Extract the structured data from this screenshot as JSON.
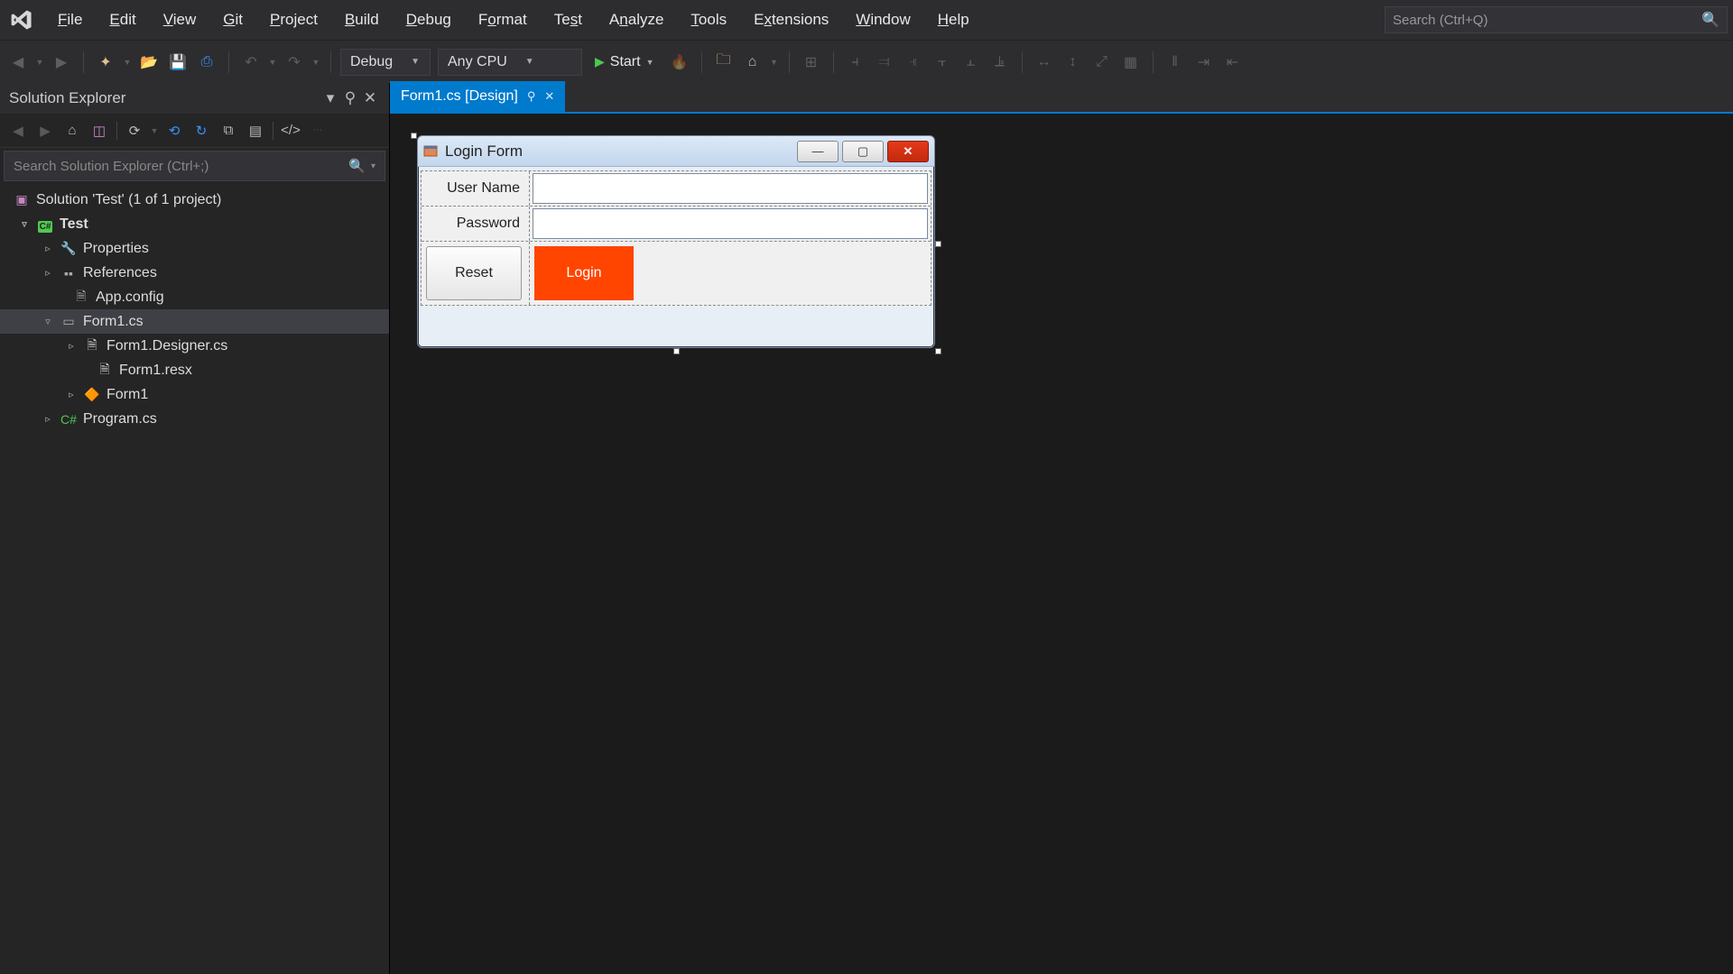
{
  "menubar": {
    "items": [
      {
        "label": "File",
        "mn": "F"
      },
      {
        "label": "Edit",
        "mn": "E"
      },
      {
        "label": "View",
        "mn": "V"
      },
      {
        "label": "Git",
        "mn": "G"
      },
      {
        "label": "Project",
        "mn": "P"
      },
      {
        "label": "Build",
        "mn": "B"
      },
      {
        "label": "Debug",
        "mn": "D"
      },
      {
        "label": "Format",
        "mn": ""
      },
      {
        "label": "Test",
        "mn": ""
      },
      {
        "label": "Analyze",
        "mn": "A"
      },
      {
        "label": "Tools",
        "mn": "T"
      },
      {
        "label": "Extensions",
        "mn": ""
      },
      {
        "label": "Window",
        "mn": "W"
      },
      {
        "label": "Help",
        "mn": "H"
      }
    ],
    "search_placeholder": "Search (Ctrl+Q)"
  },
  "toolbar": {
    "config_label": "Debug",
    "platform_label": "Any CPU",
    "start_label": "Start"
  },
  "solution_explorer": {
    "title": "Solution Explorer",
    "search_placeholder": "Search Solution Explorer (Ctrl+;)",
    "tree": {
      "solution_label": "Solution 'Test' (1 of 1 project)",
      "project_label": "Test",
      "properties_label": "Properties",
      "references_label": "References",
      "appconfig_label": "App.config",
      "form_label": "Form1.cs",
      "designer_label": "Form1.Designer.cs",
      "resx_label": "Form1.resx",
      "formclass_label": "Form1",
      "program_label": "Program.cs"
    }
  },
  "tab": {
    "label": "Form1.cs [Design]"
  },
  "designer_form": {
    "title": "Login Form",
    "labels": {
      "username": "User Name",
      "password": "Password"
    },
    "buttons": {
      "reset": "Reset",
      "login": "Login"
    },
    "values": {
      "username": "",
      "password": ""
    },
    "colors": {
      "login_bg": "#ff4500",
      "close_bg": "#e53a1a"
    }
  }
}
